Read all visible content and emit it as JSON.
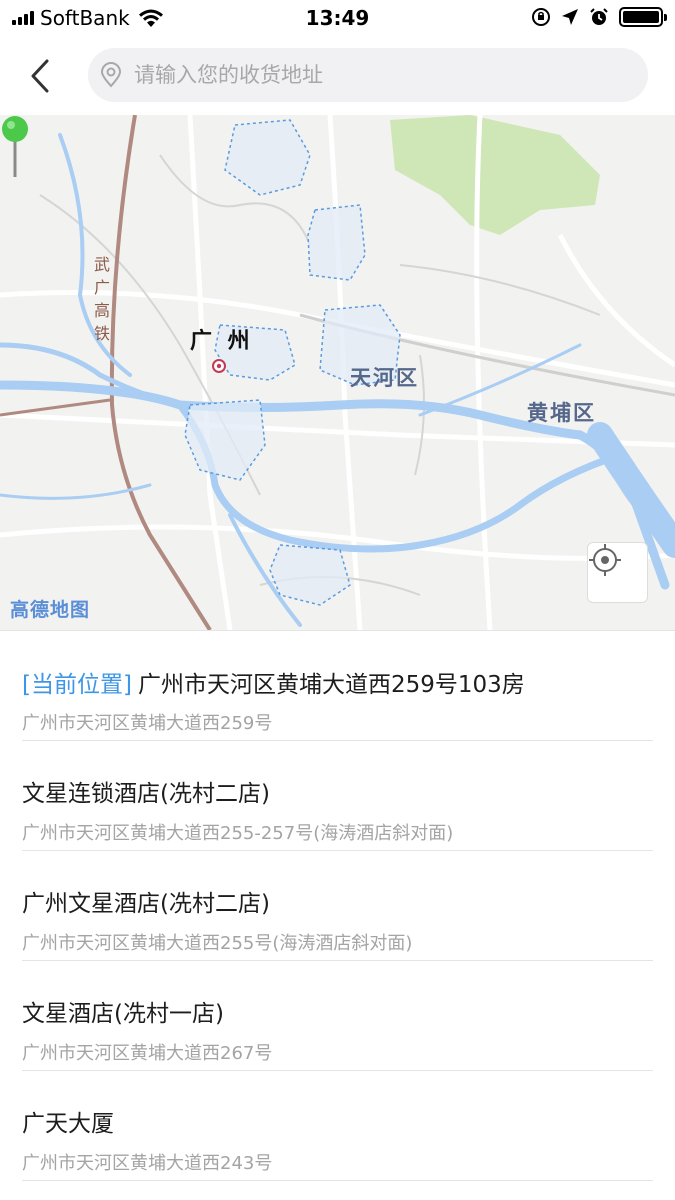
{
  "status_bar": {
    "carrier": "SoftBank",
    "time": "13:49"
  },
  "header": {
    "search_placeholder": "请输入您的收货地址",
    "icons": [
      "back-chevron-icon",
      "location-pin-icon"
    ]
  },
  "map": {
    "labels": {
      "guangzhou": "广 州",
      "tianhe": "天河区",
      "huangpu": "黄埔区",
      "railway": "武广高铁",
      "brand": "高德地图"
    },
    "colors": {
      "land": "#f2f2f0",
      "water": "#a9cdf3",
      "green": "#cfe6b6",
      "district_fill": "#e1ebf7",
      "district_border": "#5a9be0",
      "pin": "#4cc94a"
    },
    "icons": [
      "locate-target-icon",
      "green-pin-icon",
      "city-marker-icon"
    ]
  },
  "list": {
    "current_tag": "[当前位置]",
    "items": [
      {
        "title": "广州市天河区黄埔大道西259号103房",
        "subtitle": "广州市天河区黄埔大道西259号",
        "is_current": true
      },
      {
        "title": "文星连锁酒店(冼村二店)",
        "subtitle": "广州市天河区黄埔大道西255-257号(海涛酒店斜对面)"
      },
      {
        "title": "广州文星酒店(冼村二店)",
        "subtitle": "广州市天河区黄埔大道西255号(海涛酒店斜对面)"
      },
      {
        "title": "文星酒店(冼村一店)",
        "subtitle": "广州市天河区黄埔大道西267号"
      },
      {
        "title": "广天大厦",
        "subtitle": "广州市天河区黄埔大道西243号"
      }
    ]
  }
}
